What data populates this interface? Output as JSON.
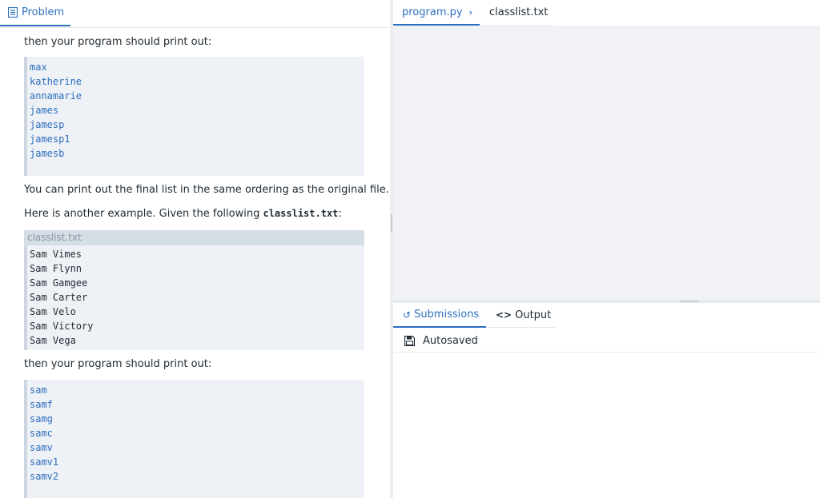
{
  "problem_tab": {
    "label": "Problem"
  },
  "content": {
    "intro": "then your program should print out:",
    "output1": [
      "max",
      "katherine",
      "annamarie",
      "james",
      "jamesp",
      "jamesp1",
      "jamesb"
    ],
    "ordering_note": "You can print out the final list in the same ordering as the original file.",
    "example_prefix": "Here is another example. Given the following ",
    "example_file": "classlist.txt",
    "example_suffix": ":",
    "file_header": "classlist.txt",
    "file_lines": [
      "Sam Vimes",
      "Sam Flynn",
      "Sam Gamgee",
      "Sam Carter",
      "Sam Velo",
      "Sam Victory",
      "Sam Vega"
    ],
    "intro2": "then your program should print out:",
    "output2": [
      "sam",
      "samf",
      "samg",
      "samc",
      "samv",
      "samv1",
      "samv2"
    ]
  },
  "editor_tabs": {
    "program": "program.py",
    "classlist": "classlist.txt"
  },
  "bottom_tabs": {
    "submissions": "Submissions",
    "output": "Output"
  },
  "status": {
    "autosaved": "Autosaved"
  },
  "colors": {
    "accent": "#2c6fbf",
    "editor_bg": "#f0f2f5",
    "code_bg": "#eef1f5"
  }
}
